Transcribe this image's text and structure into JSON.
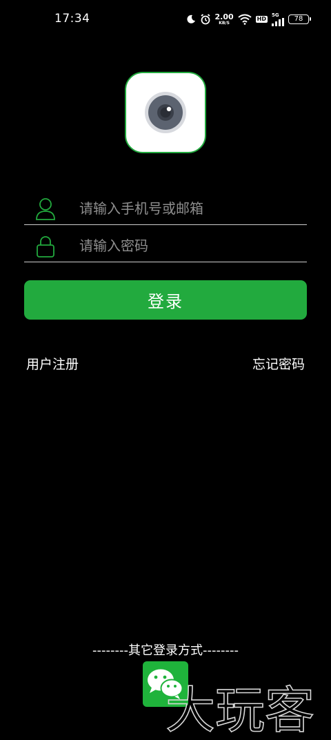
{
  "status_bar": {
    "time": "17:34",
    "net_speed_value": "2.00",
    "net_speed_unit": "KB/S",
    "hd_label": "HD",
    "signal_label": "5G",
    "battery_level": "78",
    "icons": [
      "moon-icon",
      "alarm-icon",
      "wifi-icon",
      "signal-icon",
      "battery-icon"
    ]
  },
  "login": {
    "account_placeholder": "请输入手机号或邮箱",
    "password_placeholder": "请输入密码",
    "submit_label": "登录",
    "register_label": "用户注册",
    "forgot_label": "忘记密码",
    "other_methods_label": "--------其它登录方式--------"
  },
  "watermark_text": "大玩客",
  "colors": {
    "accent": "#22aa3e",
    "background": "#000000",
    "underline": "#cfcfcf",
    "placeholder": "#8e8e8e"
  }
}
